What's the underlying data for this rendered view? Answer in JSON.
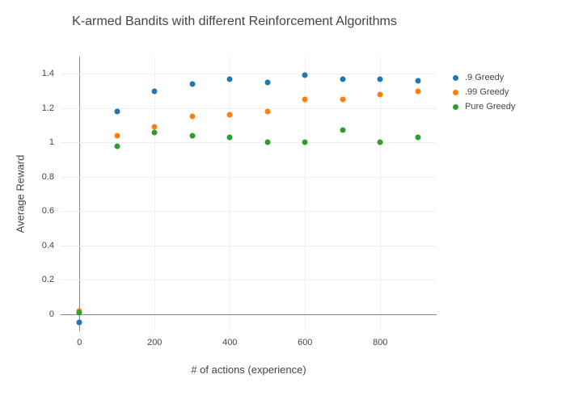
{
  "chart_data": {
    "type": "scatter",
    "title": "K-armed Bandits with different Reinforcement Algorithms",
    "xlabel": "# of actions (experience)",
    "ylabel": "Average Reward",
    "xlim": [
      -50,
      950
    ],
    "ylim": [
      -0.1,
      1.5
    ],
    "x_ticks": [
      0,
      200,
      400,
      600,
      800
    ],
    "y_ticks": [
      0,
      0.2,
      0.4,
      0.6,
      0.8,
      1,
      1.2,
      1.4
    ],
    "x": [
      0,
      100,
      200,
      300,
      400,
      500,
      600,
      700,
      800,
      900
    ],
    "series": [
      {
        "name": ".9 Greedy",
        "color": "#1f77b4",
        "values": [
          -0.05,
          1.18,
          1.3,
          1.34,
          1.37,
          1.35,
          1.39,
          1.37,
          1.37,
          1.36
        ]
      },
      {
        "name": ".99 Greedy",
        "color": "#ff7f0e",
        "values": [
          0.02,
          1.04,
          1.09,
          1.15,
          1.16,
          1.18,
          1.25,
          1.25,
          1.28,
          1.3
        ]
      },
      {
        "name": "Pure Greedy",
        "color": "#2ca02c",
        "values": [
          0.01,
          0.98,
          1.06,
          1.04,
          1.03,
          1.0,
          1.0,
          1.07,
          1.0,
          1.03
        ]
      }
    ]
  }
}
